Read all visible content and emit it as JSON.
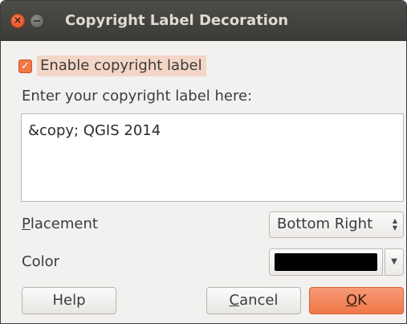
{
  "window": {
    "title": "Copyright Label Decoration",
    "close_glyph": "×"
  },
  "enable": {
    "label": "Enable copyright label",
    "checked": true,
    "check_glyph": "✓"
  },
  "prompt": "Enter your copyright label here:",
  "label_text": "&copy; QGIS 2014",
  "placement": {
    "label_first": "P",
    "label_rest": "lacement",
    "value": "Bottom Right",
    "arrows": "▲\n▼"
  },
  "color": {
    "label": "Color",
    "value": "#000000",
    "drop_glyph": "▼"
  },
  "buttons": {
    "help": "Help",
    "cancel_first": "C",
    "cancel_rest": "ancel",
    "ok_first": "O",
    "ok_rest": "K"
  },
  "icons": {
    "close": "close-icon",
    "minimize": "minimize-icon",
    "check": "check-icon",
    "spin_arrows": "spin-arrows-icon",
    "dropdown": "chevron-down-icon"
  }
}
